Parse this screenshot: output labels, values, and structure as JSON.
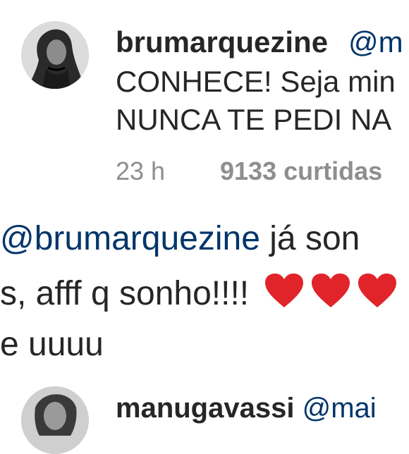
{
  "comment1": {
    "username": "brumarquezine",
    "mention_start": "@m",
    "line2": "CONHECE! Seja min",
    "line3": "NUNCA TE PEDI NA",
    "time": "23 h",
    "likes": "9133 curtidas"
  },
  "comment2": {
    "mention": "@brumarquezine",
    "line1_rest": " já son",
    "line2": "s, afff q sonho!!!!",
    "line3": "e uuuu",
    "hearts": [
      "heart-icon",
      "heart-icon",
      "heart-icon"
    ],
    "heart_color": "#e0242a"
  },
  "comment3": {
    "username": "manugavassi",
    "mention_start": "@mai"
  },
  "colors": {
    "text": "#262626",
    "mention": "#003569",
    "meta": "#8e8e8e"
  }
}
